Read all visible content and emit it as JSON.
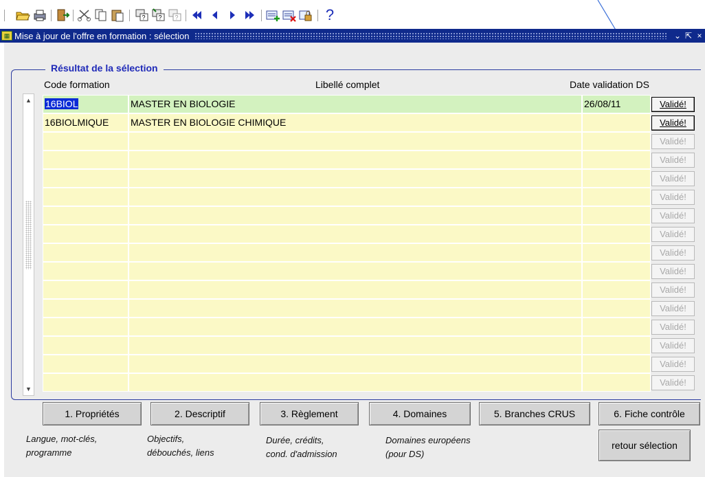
{
  "toolbar": {
    "icons": [
      "open-folder-icon",
      "print-icon",
      "exit-door-icon",
      "cut-icon",
      "copy-icon",
      "paste-icon",
      "query-enter-icon",
      "query-execute-icon",
      "query-cancel-icon",
      "first-record-icon",
      "previous-record-icon",
      "next-record-icon",
      "last-record-icon",
      "insert-record-icon",
      "delete-record-icon",
      "lock-record-icon",
      "help-icon"
    ],
    "help_glyph": "?"
  },
  "window": {
    "title": "Mise à jour de l'offre en formation : sélection"
  },
  "group": {
    "title": "Résultat de la sélection"
  },
  "columns": {
    "code": "Code formation",
    "libelle": "Libellé complet",
    "date": "Date validation DS"
  },
  "rows": [
    {
      "code": "16BIOL",
      "libelle": "MASTER EN BIOLOGIE",
      "date": "26/08/11",
      "button": "Validé!",
      "state": "selected"
    },
    {
      "code": "16BIOLMIQUE",
      "libelle": "MASTER EN BIOLOGIE CHIMIQUE",
      "date": "",
      "button": "Validé!",
      "state": "active"
    },
    {
      "code": "",
      "libelle": "",
      "date": "",
      "button": "Validé!",
      "state": "disabled"
    },
    {
      "code": "",
      "libelle": "",
      "date": "",
      "button": "Validé!",
      "state": "disabled"
    },
    {
      "code": "",
      "libelle": "",
      "date": "",
      "button": "Validé!",
      "state": "disabled"
    },
    {
      "code": "",
      "libelle": "",
      "date": "",
      "button": "Validé!",
      "state": "disabled"
    },
    {
      "code": "",
      "libelle": "",
      "date": "",
      "button": "Validé!",
      "state": "disabled"
    },
    {
      "code": "",
      "libelle": "",
      "date": "",
      "button": "Validé!",
      "state": "disabled"
    },
    {
      "code": "",
      "libelle": "",
      "date": "",
      "button": "Validé!",
      "state": "disabled"
    },
    {
      "code": "",
      "libelle": "",
      "date": "",
      "button": "Validé!",
      "state": "disabled"
    },
    {
      "code": "",
      "libelle": "",
      "date": "",
      "button": "Validé!",
      "state": "disabled"
    },
    {
      "code": "",
      "libelle": "",
      "date": "",
      "button": "Validé!",
      "state": "disabled"
    },
    {
      "code": "",
      "libelle": "",
      "date": "",
      "button": "Validé!",
      "state": "disabled"
    },
    {
      "code": "",
      "libelle": "",
      "date": "",
      "button": "Validé!",
      "state": "disabled"
    },
    {
      "code": "",
      "libelle": "",
      "date": "",
      "button": "Validé!",
      "state": "disabled"
    },
    {
      "code": "",
      "libelle": "",
      "date": "",
      "button": "Validé!",
      "state": "disabled"
    }
  ],
  "buttons": {
    "proprietes": "1. Propriétés",
    "descriptif": "2. Descriptif",
    "reglement": "3. Règlement",
    "domaines": "4. Domaines",
    "branches": "5. Branches CRUS",
    "fiche": "6. Fiche contrôle",
    "retour": "retour sélection"
  },
  "hints": {
    "proprietes": [
      "Langue, mot-clés,",
      "programme"
    ],
    "descriptif": [
      "Objectifs,",
      "débouchés, liens"
    ],
    "reglement": [
      "Durée, crédits,",
      "cond. d'admission"
    ],
    "domaines": [
      "Domaines européens",
      "(pour DS)"
    ]
  },
  "colors": {
    "title_bar": "#0f2a8c",
    "group_title": "#1f2ab8",
    "row_bg": "#fbf9c6",
    "row_selected_bg": "#d3f2bf",
    "code_highlight": "#0b2bd6",
    "annotation_arrow": "#3a6fd8"
  }
}
